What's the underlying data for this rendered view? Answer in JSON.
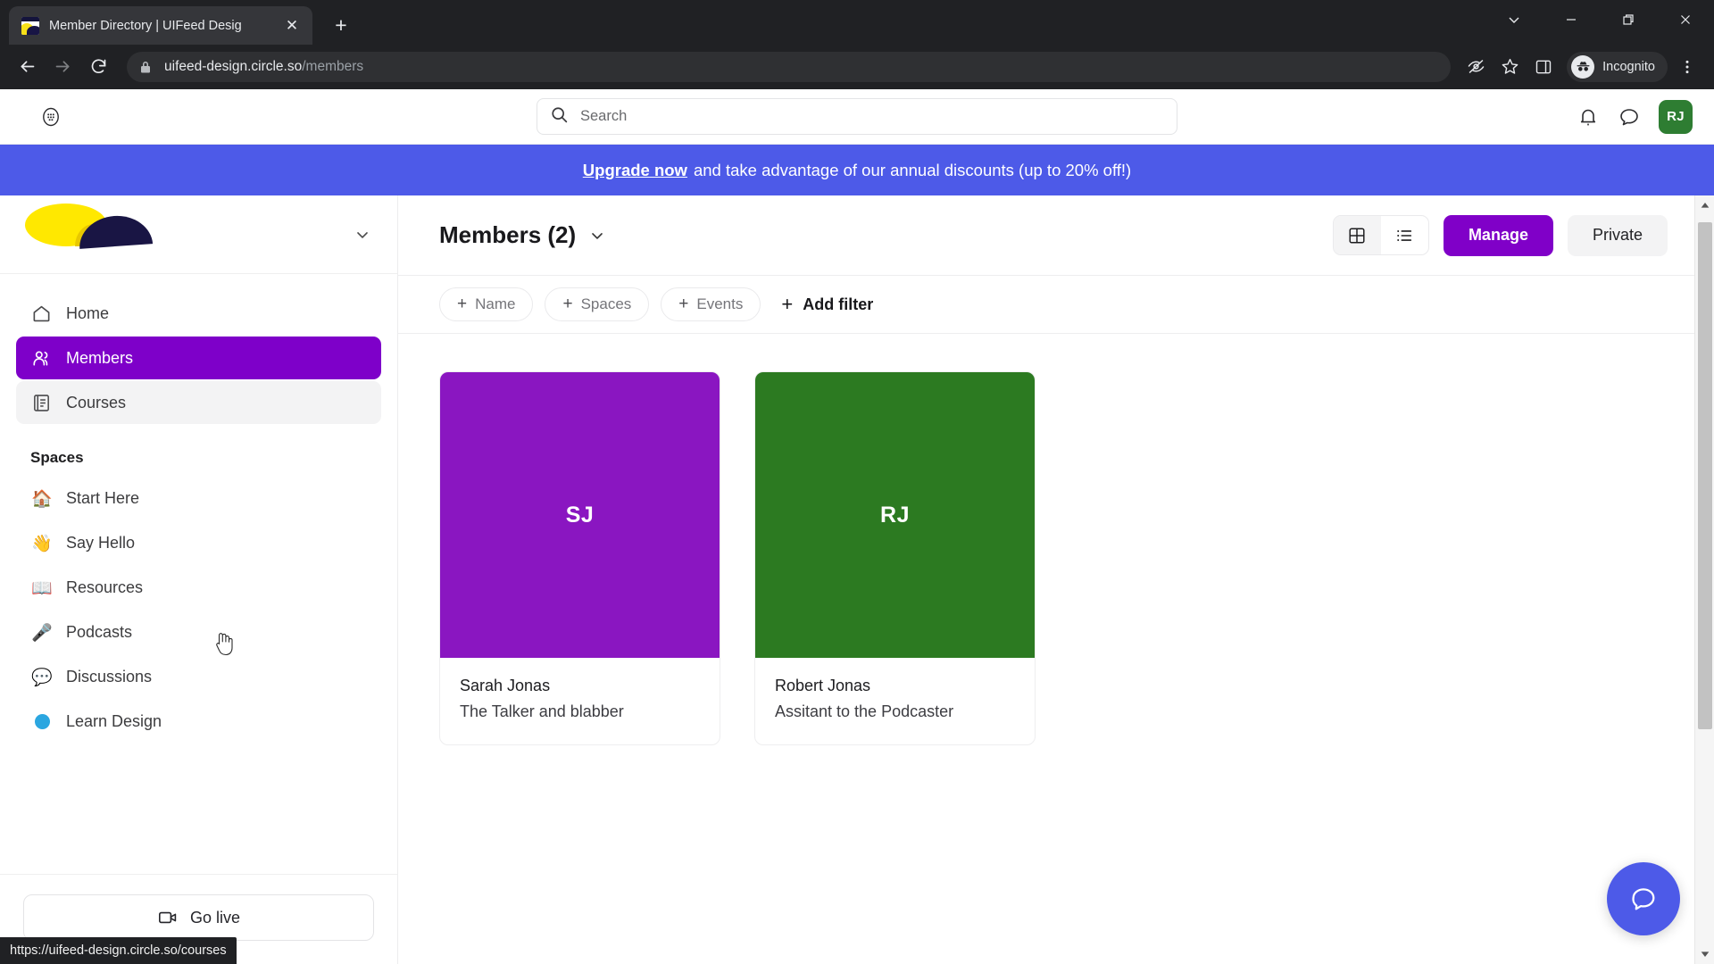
{
  "browser": {
    "tab": {
      "title": "Member Directory | UIFeed Desig",
      "close_label": "✕",
      "favicon_name": "uifeed-favicon"
    },
    "newtab_label": "+",
    "window_controls": [
      "tab-search",
      "minimize",
      "maximize",
      "close"
    ],
    "toolbar": {
      "back_label": "←",
      "forward_label": "→",
      "reload_label": "↻",
      "url_domain": "uifeed-design.circle.so",
      "url_path": "/members",
      "incognito_label": "Incognito",
      "icons": [
        "third-party-cookie-blocked",
        "bookmark-star",
        "side-panel",
        "chrome-menu"
      ]
    },
    "statusbar_url": "https://uifeed-design.circle.so/courses"
  },
  "app": {
    "header": {
      "apps_icon": "apps-grid-icon",
      "search_placeholder": "Search",
      "search_value": "",
      "notification_icon": "bell-icon",
      "messages_icon": "chat-bubble-icon",
      "avatar_initials": "RJ",
      "avatar_color": "#2e7d32"
    },
    "banner": {
      "link_text": "Upgrade now",
      "text": "and take advantage of our annual discounts (up to 20% off!)",
      "background": "#4d5ae8"
    },
    "sidebar": {
      "brand_name": "uifeed-logo",
      "collapse_icon": "chevron-down-icon",
      "nav": [
        {
          "label": "Home",
          "icon": "home-icon",
          "active": false,
          "hovered": false
        },
        {
          "label": "Members",
          "icon": "members-icon",
          "active": true,
          "hovered": false
        },
        {
          "label": "Courses",
          "icon": "courses-icon",
          "active": false,
          "hovered": true
        }
      ],
      "spaces_title": "Spaces",
      "spaces": [
        {
          "label": "Start Here",
          "emoji": "🏠"
        },
        {
          "label": "Say Hello",
          "emoji": "👋"
        },
        {
          "label": "Resources",
          "emoji": "📖"
        },
        {
          "label": "Podcasts",
          "emoji": "🎤"
        },
        {
          "label": "Discussions",
          "emoji": "💬"
        },
        {
          "label": "Learn Design",
          "emoji": "🔵"
        }
      ],
      "go_live_label": "Go live",
      "go_live_icon": "video-camera-icon"
    },
    "main": {
      "title": "Members (2)",
      "title_chevron": "chevron-down-icon",
      "view_toggle": {
        "grid_label": "grid-view-icon",
        "list_label": "list-view-icon",
        "selected": "grid"
      },
      "manage_label": "Manage",
      "manage_color": "#8000c8",
      "private_label": "Private",
      "filters": [
        {
          "label": "Name",
          "plus": "+"
        },
        {
          "label": "Spaces",
          "plus": "+"
        },
        {
          "label": "Events",
          "plus": "+"
        }
      ],
      "add_filter_label": "Add filter",
      "add_filter_plus": "+",
      "members": [
        {
          "initials": "SJ",
          "name": "Sarah Jonas",
          "role": "The Talker and blabber",
          "color": "#8a16c1"
        },
        {
          "initials": "RJ",
          "name": "Robert Jonas",
          "role": "Assitant to the Podcaster",
          "color": "#2c7a21"
        }
      ],
      "fab_icon": "chat-bubble-icon",
      "fab_color": "#4d5ae8"
    }
  }
}
